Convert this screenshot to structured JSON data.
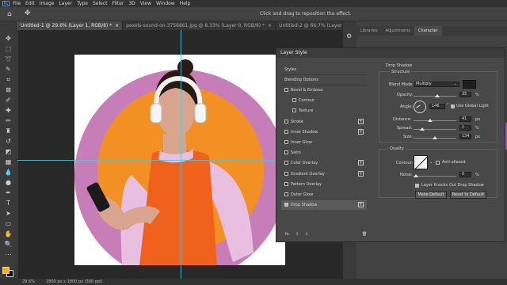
{
  "menu": [
    "File",
    "Edit",
    "Image",
    "Layer",
    "Type",
    "Select",
    "Filter",
    "3D",
    "View",
    "Window",
    "Help"
  ],
  "options_bar": {
    "hint": "Click and drag to reposition the effect."
  },
  "doc_tabs": [
    {
      "label": "Untitled-1 @ 29.6% (Layer 1, RGB/8) *",
      "active": true
    },
    {
      "label": "pexels-sound-on-3756861.jpg @ 8.33% (Layer 0, RGB/8) *",
      "active": false
    },
    {
      "label": "Untitled-2 @ 66.7% (Layer 0, RGB/8) *",
      "active": false
    }
  ],
  "panel_tabs": [
    "Libraries",
    "Adjustments",
    "Character"
  ],
  "status": {
    "zoom": "29.6%",
    "doc_info": "1800 px x 1800 px (300 ppi)"
  },
  "colors": {
    "foreground": "#f7b500",
    "background": "#0a0a0a",
    "circle_pink": "#c77db8",
    "circle_orange": "#f39024",
    "guide": "#4cc6d8"
  },
  "dialog": {
    "title": "Layer Style",
    "styles_header": "Styles",
    "blending_options": "Blending Options",
    "effects": [
      {
        "label": "Bevel & Emboss",
        "checked": false,
        "plus": false,
        "sub": false
      },
      {
        "label": "Contour",
        "checked": false,
        "plus": false,
        "sub": true
      },
      {
        "label": "Texture",
        "checked": false,
        "plus": false,
        "sub": true
      },
      {
        "label": "Stroke",
        "checked": false,
        "plus": true,
        "sub": false
      },
      {
        "label": "Inner Shadow",
        "checked": false,
        "plus": true,
        "sub": false
      },
      {
        "label": "Inner Glow",
        "checked": false,
        "plus": false,
        "sub": false
      },
      {
        "label": "Satin",
        "checked": false,
        "plus": false,
        "sub": false
      },
      {
        "label": "Color Overlay",
        "checked": false,
        "plus": true,
        "sub": false
      },
      {
        "label": "Gradient Overlay",
        "checked": false,
        "plus": true,
        "sub": false
      },
      {
        "label": "Pattern Overlay",
        "checked": false,
        "plus": false,
        "sub": false
      },
      {
        "label": "Outer Glow",
        "checked": false,
        "plus": false,
        "sub": false
      },
      {
        "label": "Drop Shadow",
        "checked": true,
        "plus": true,
        "sub": false
      }
    ],
    "footer_fx": "fx.",
    "drop_shadow": {
      "title": "Drop Shadow",
      "structure": "Structure",
      "blend_mode_label": "Blend Mode:",
      "blend_mode": "Multiply",
      "opacity_label": "Opacity:",
      "opacity": "35",
      "angle_label": "Angle:",
      "angle": "146",
      "global_light": "Use Global Light",
      "distance_label": "Distance:",
      "distance": "41",
      "spread_label": "Spread:",
      "spread": "0",
      "size_label": "Size:",
      "size": "134",
      "unit_pct": "%",
      "unit_px": "px",
      "quality": "Quality",
      "contour_label": "Contour:",
      "anti_aliased": "Anti-aliased",
      "noise_label": "Noise:",
      "noise": "0",
      "knockout": "Layer Knocks Out Drop Shadow",
      "make_default": "Make Default",
      "reset_default": "Reset to Default"
    }
  }
}
